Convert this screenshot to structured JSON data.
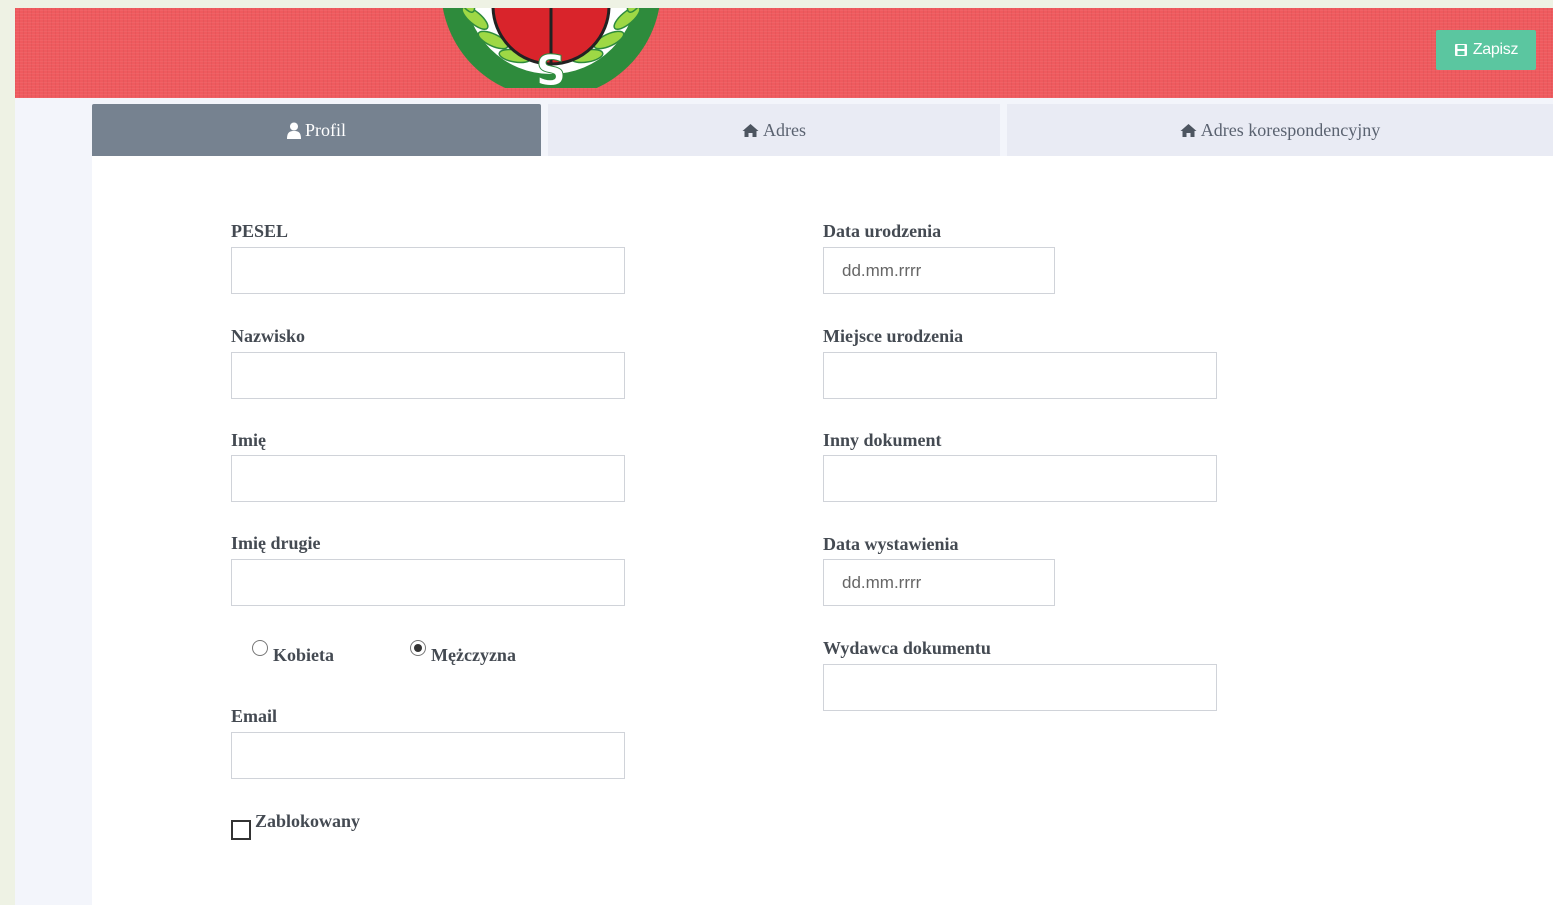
{
  "header": {
    "logo_letter": "S",
    "save_label": "Zapisz",
    "colors": {
      "header_bg": "#ef5a5e",
      "save_bg": "#5bc6a0"
    }
  },
  "tabs": [
    {
      "label": "Profil",
      "icon": "user-icon",
      "active": true
    },
    {
      "label": "Adres",
      "icon": "home-icon",
      "active": false
    },
    {
      "label": "Adres korespondencyjny",
      "icon": "home-icon",
      "active": false
    }
  ],
  "form": {
    "pesel": {
      "label": "PESEL",
      "value": ""
    },
    "nazwisko": {
      "label": "Nazwisko",
      "value": ""
    },
    "imie": {
      "label": "Imię",
      "value": ""
    },
    "imie_drugie": {
      "label": "Imię drugie",
      "value": ""
    },
    "gender": {
      "options": [
        {
          "label": "Kobieta",
          "checked": false
        },
        {
          "label": "Mężczyzna",
          "checked": true
        }
      ]
    },
    "email": {
      "label": "Email",
      "value": ""
    },
    "zablokowany": {
      "label": "Zablokowany",
      "checked": false
    },
    "data_urodzenia": {
      "label": "Data urodzenia",
      "placeholder": "dd.mm.rrrr"
    },
    "miejsce_urodzenia": {
      "label": "Miejsce urodzenia",
      "value": ""
    },
    "inny_dokument": {
      "label": "Inny dokument",
      "value": ""
    },
    "data_wystawienia": {
      "label": "Data wystawienia",
      "placeholder": "dd.mm.rrrr"
    },
    "wydawca_dokumentu": {
      "label": "Wydawca dokumentu",
      "value": ""
    }
  }
}
